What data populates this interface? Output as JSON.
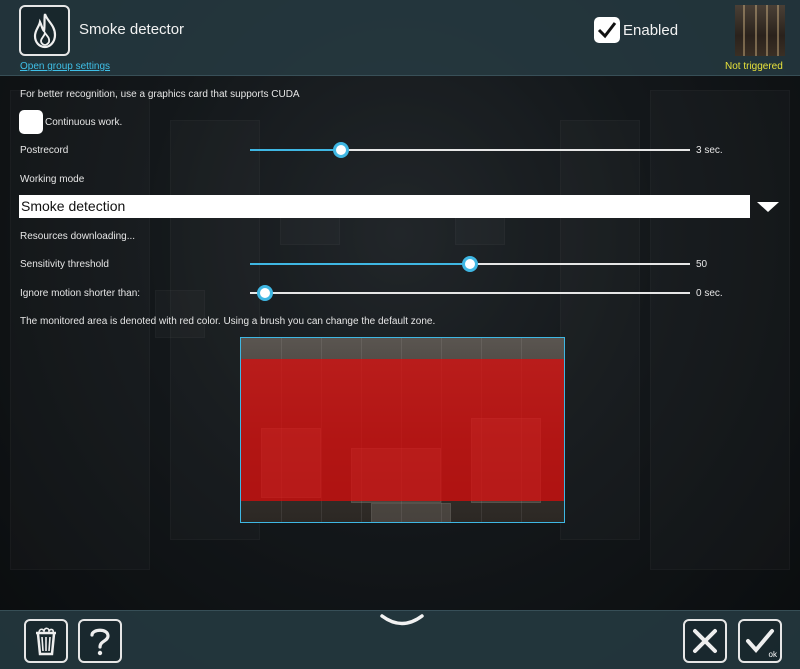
{
  "header": {
    "title": "Smoke detector",
    "group_settings_link": "Open group settings",
    "enabled_label": "Enabled",
    "enabled_checked": true,
    "status": "Not triggered"
  },
  "settings": {
    "cuda_hint": "For better recognition, use a graphics card that supports CUDA",
    "continuous_work": {
      "label": "Continuous work.",
      "checked": false
    },
    "postrecord": {
      "label": "Postrecord",
      "value_text": "3 sec.",
      "fraction": 0.206
    },
    "working_mode": {
      "label": "Working mode",
      "selected": "Smoke detection"
    },
    "resources_status": "Resources downloading...",
    "sensitivity": {
      "label": "Sensitivity threshold",
      "value_text": "50",
      "fraction": 0.5
    },
    "ignore_motion": {
      "label": "Ignore motion shorter than:",
      "value_text": "0 sec.",
      "fraction": 0.0
    },
    "zone_hint": "The monitored area is denoted with red color. Using a brush you can change the default zone."
  },
  "colors": {
    "accent": "#3fb7e3",
    "status": "#e8e23a",
    "zone": "#e10a0a"
  },
  "footer": {
    "delete_icon": "trash-icon",
    "help_icon": "question-icon",
    "collapse_icon": "chevron-down-icon",
    "cancel_icon": "close-icon",
    "ok_icon": "check-icon",
    "ok_label": "ok"
  }
}
